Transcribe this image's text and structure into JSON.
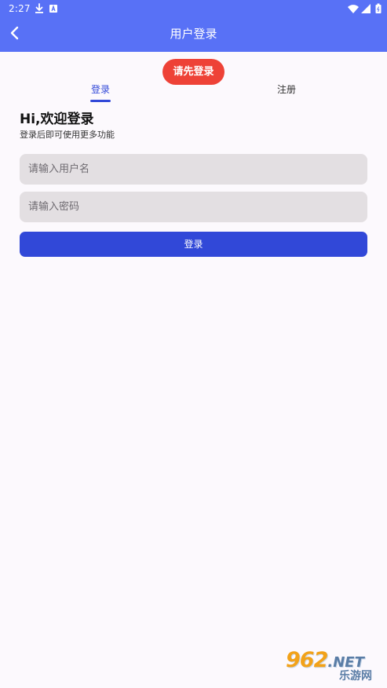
{
  "status_bar": {
    "time": "2:27",
    "left_icons": [
      "download-icon",
      "app-notification-icon"
    ],
    "right_icons": [
      "wifi-icon",
      "signal-icon",
      "battery-icon"
    ]
  },
  "app_bar": {
    "title": "用户登录",
    "back_icon": "chevron-left-icon",
    "background_color": "#5871f6"
  },
  "toast": {
    "text": "请先登录",
    "color": "#ee4237"
  },
  "tabs": [
    {
      "label": "登录",
      "active": true
    },
    {
      "label": "注册",
      "active": false
    }
  ],
  "form": {
    "title": "Hi,欢迎登录",
    "subtitle": "登录后即可使用更多功能",
    "username": {
      "value": "",
      "placeholder": "请输入用户名"
    },
    "password": {
      "value": "",
      "placeholder": "请输入密码"
    },
    "submit_label": "登录",
    "accent_color": "#3148d8"
  },
  "watermark": {
    "brand": "962",
    "suffix": ".NET",
    "sub": "乐游网"
  }
}
